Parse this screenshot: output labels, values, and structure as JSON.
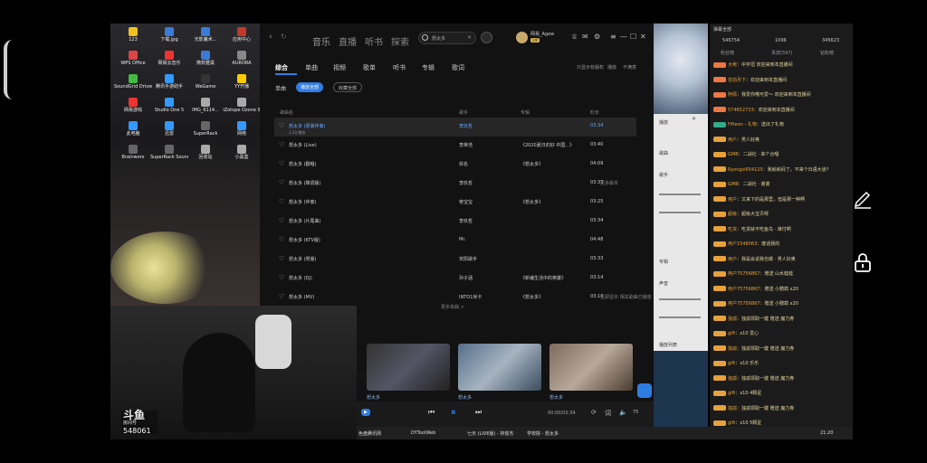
{
  "desktop": {
    "icons": [
      {
        "label": "123",
        "color": "#f0c020"
      },
      {
        "label": "下载.jpg",
        "color": "#3a7bd5"
      },
      {
        "label": "光影魔术...",
        "color": "#3a7bd5"
      },
      {
        "label": "应用中心",
        "color": "#c0392b"
      },
      {
        "label": "WPS Office",
        "color": "#d44"
      },
      {
        "label": "网易云音乐",
        "color": "#e33"
      },
      {
        "label": "微软雅黑",
        "color": "#3a7bd5"
      },
      {
        "label": "AURORA",
        "color": "#888"
      },
      {
        "label": "SoundGrid Driver C...",
        "color": "#4b4"
      },
      {
        "label": "腾讯手游助手",
        "color": "#39f"
      },
      {
        "label": "WeGame",
        "color": "#333"
      },
      {
        "label": "YY开播",
        "color": "#fc0"
      },
      {
        "label": "网易游戏",
        "color": "#e33"
      },
      {
        "label": "Studio One 5",
        "color": "#39f"
      },
      {
        "label": "IMG_6114...",
        "color": "#aaa"
      },
      {
        "label": "iZotope Ozone 9",
        "color": "#aaa"
      },
      {
        "label": "此电脑",
        "color": "#39f"
      },
      {
        "label": "迅雷",
        "color": "#39f"
      },
      {
        "label": "SuperRack",
        "color": "#666"
      },
      {
        "label": "网络",
        "color": "#39f"
      },
      {
        "label": "Brainworx",
        "color": "#666"
      },
      {
        "label": "SuperRack SoundGrid",
        "color": "#666"
      },
      {
        "label": "回收站",
        "color": "#aaa"
      },
      {
        "label": "小黑盒",
        "color": "#aaa"
      }
    ],
    "widgets": [
      "Waves Central",
      "Waves Applications",
      "Waves eMotion LV1"
    ]
  },
  "player": {
    "nav_tabs": [
      "音乐",
      "直播",
      "听书",
      "探索"
    ],
    "search": {
      "value": "想太多",
      "icon": "search-icon"
    },
    "user": {
      "name": "网易_Agew",
      "vip": "VIP"
    },
    "filter_tabs": [
      "综合",
      "单曲",
      "视频",
      "歌单",
      "听书",
      "专辑",
      "歌词"
    ],
    "filter_active": "综合",
    "section_label": "单曲",
    "chips": [
      "播放全部",
      "收藏全部"
    ],
    "right_filters": [
      "只显示有版权",
      "播放",
      "不满意"
    ],
    "columns": {
      "title": "歌曲名",
      "artist": "歌手",
      "album": "专辑",
      "duration": "时长"
    },
    "songs": [
      {
        "title": "想太多 (原版伴奏)",
        "artist": "李玖哲",
        "album": "",
        "duration": "03:34",
        "selected": true,
        "extra": "3.2亿播放"
      },
      {
        "title": "想太多 (Live)",
        "artist": "李荣浩",
        "album": "《2020夏日的好 中国...》",
        "duration": "03:40",
        "selected": false,
        "extra": ""
      },
      {
        "title": "想太多 (翻唱)",
        "artist": "佚名",
        "album": "《想太多》",
        "duration": "04:09",
        "selected": false,
        "extra": ""
      },
      {
        "title": "想太多 (降调版)",
        "artist": "李玖哲",
        "album": "",
        "duration": "03:33",
        "selected": false,
        "extra": "更多版本"
      },
      {
        "title": "想太多 (伴奏)",
        "artist": "蒋宝宝",
        "album": "《想太多》",
        "duration": "03:25",
        "selected": false,
        "extra": ""
      },
      {
        "title": "想太多 (片尾曲)",
        "artist": "李玖哲",
        "album": "",
        "duration": "03:34",
        "selected": false,
        "extra": ""
      },
      {
        "title": "想太多 (KTV版)",
        "artist": "Mr.",
        "album": "",
        "duration": "04:48",
        "selected": false,
        "extra": ""
      },
      {
        "title": "想太多 (男版)",
        "artist": "宋阳歌手",
        "album": "",
        "duration": "03:33",
        "selected": false,
        "extra": ""
      },
      {
        "title": "想太多 (DJ)",
        "artist": "孙子涵",
        "album": "《新编生活中的英雄》",
        "duration": "03:14",
        "selected": false,
        "extra": ""
      },
      {
        "title": "想太多 (MV)",
        "artist": "INTO1米卡",
        "album": "《想太多》",
        "duration": "03:16",
        "selected": false,
        "extra": "立即显示 相关歌曲已播放"
      }
    ],
    "more_results": "更多单曲 >",
    "mv_captions": [
      "想太多",
      "想太多",
      "想太多"
    ],
    "playback": {
      "time": "00:00/03:34",
      "speed": "75"
    }
  },
  "mini_panel": {
    "title": "播放",
    "items": [
      "歌曲",
      "歌手",
      "专辑",
      "声音",
      "播放列表"
    ],
    "values": [
      "0",
      "100",
      "50",
      "100"
    ]
  },
  "chat": {
    "header": "弹幕全部",
    "stats": [
      "546754",
      "1096",
      "345623"
    ],
    "tabs": [
      "粉丝榜",
      "贵宾(597)",
      "钻粉榜"
    ],
    "messages": [
      {
        "user": "大佬",
        "text": "中宇坦 欢迎来到本直播间",
        "badge": "#e74"
      },
      {
        "user": "花前月下",
        "text": "欢迎来到本直播间",
        "badge": "#e74"
      },
      {
        "user": "阿倩",
        "text": "我爱你哦可爱～ 欢迎来到本直播间",
        "badge": "#e74"
      },
      {
        "user": "574652733",
        "text": "欢迎来到本直播间",
        "badge": "#e74"
      },
      {
        "user": "Fifteen - 礼物",
        "text": "送出了礼物",
        "badge": "#3a8"
      },
      {
        "user": "用户",
        "text": "男人好奥",
        "badge": "#e6a23c"
      },
      {
        "user": "GMB",
        "text": "二战社 · 来个合唱",
        "badge": "#e6a23c"
      },
      {
        "user": "Ryongsi654125",
        "text": "我就纳闷了，不来个日语大道?",
        "badge": "#e6a23c"
      },
      {
        "user": "GMB",
        "text": "二战社 · 谢谢",
        "badge": "#e6a23c"
      },
      {
        "user": "用户",
        "text": "又来下的是那里，但是那一种啊",
        "badge": "#e6a23c"
      },
      {
        "user": "超级",
        "text": "超级大宝贝呀",
        "badge": "#e6a23c"
      },
      {
        "user": "吃货",
        "text": "吃货就不吃鱼鸟 · 谁付啊",
        "badge": "#e6a23c"
      },
      {
        "user": "用户1548063",
        "text": "废话我的",
        "badge": "#e6a23c"
      },
      {
        "user": "用户",
        "text": "我是会说我也做 · 男人好奥",
        "badge": "#e6a23c"
      },
      {
        "user": "用户75756867",
        "text": "赠送 山水蛙蛙",
        "badge": "#e6a23c"
      },
      {
        "user": "用户75756867",
        "text": "赠送 小鹦鹉 x20",
        "badge": "#e6a23c"
      },
      {
        "user": "用户75756867",
        "text": "赠送 小鹦鹉 x20",
        "badge": "#e6a23c"
      },
      {
        "user": "独孤",
        "text": "独孤领取一键 赠送 魔力券",
        "badge": "#e6a23c"
      },
      {
        "user": "gift",
        "text": "x10 爱心",
        "badge": "#e6a23c"
      },
      {
        "user": "独孤",
        "text": "独孤领取一键 赠送 魔力券",
        "badge": "#e6a23c"
      },
      {
        "user": "gift",
        "text": "x10 乐乐",
        "badge": "#e6a23c"
      },
      {
        "user": "独孤",
        "text": "独孤领取一键 赠送 魔力券",
        "badge": "#e6a23c"
      },
      {
        "user": "gift",
        "text": "x10 4颗星",
        "badge": "#e6a23c"
      },
      {
        "user": "独孤",
        "text": "独孤领取一键 赠送 魔力券",
        "badge": "#e6a23c"
      },
      {
        "user": "gift",
        "text": "x10 5颗星",
        "badge": "#e6a23c"
      }
    ]
  },
  "cam": {
    "brand": "斗鱼",
    "room_label": "房间号",
    "room_no": "548061"
  },
  "taskbar": {
    "items": [
      "色盘腾讯网",
      "DYToolWeb",
      "七天 (LIVE版) - 林俊杰",
      "学校院 - 想太多"
    ],
    "time": "21:20"
  },
  "colors": {
    "accent": "#2f7de1",
    "bg": "#121212",
    "chat_text": "#e6d6a0"
  }
}
